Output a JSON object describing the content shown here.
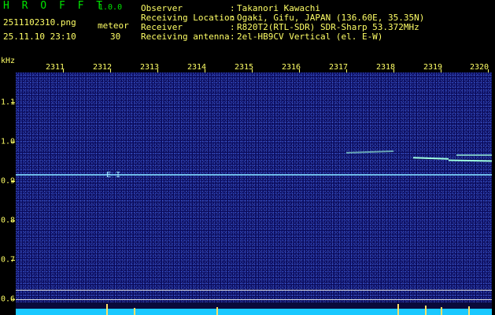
{
  "header": {
    "logo": "H R O F F T",
    "version": "1.0.0",
    "filename": "2511102310.png",
    "meteor_label": "meteor",
    "datetime": "25.11.10 23:10",
    "meteor_count": "30",
    "fields": [
      {
        "label": "Observer",
        "value": "Takanori Kawachi"
      },
      {
        "label": "Receiving Location",
        "value": "Ogaki, Gifu, JAPAN (136.60E, 35.35N)"
      },
      {
        "label": "Receiver",
        "value": "R820T2(RTL-SDR) SDR-Sharp 53.372MHz"
      },
      {
        "label": "Receiving antenna",
        "value": "2el-HB9CV Vertical (el. E-W)"
      }
    ]
  },
  "axis": {
    "unit": "kHz",
    "minutes": [
      "2311",
      "2312",
      "2313",
      "2314",
      "2315",
      "2316",
      "2317",
      "2318",
      "2319",
      "2320"
    ],
    "freq_labels": [
      "1.1",
      "1.0",
      "0.9",
      "0.8",
      "0.7",
      "0.6"
    ]
  },
  "colors": {
    "text_green": "#00e400",
    "text_yellow": "#ffff66",
    "background_noise": "#0a0a5a"
  }
}
